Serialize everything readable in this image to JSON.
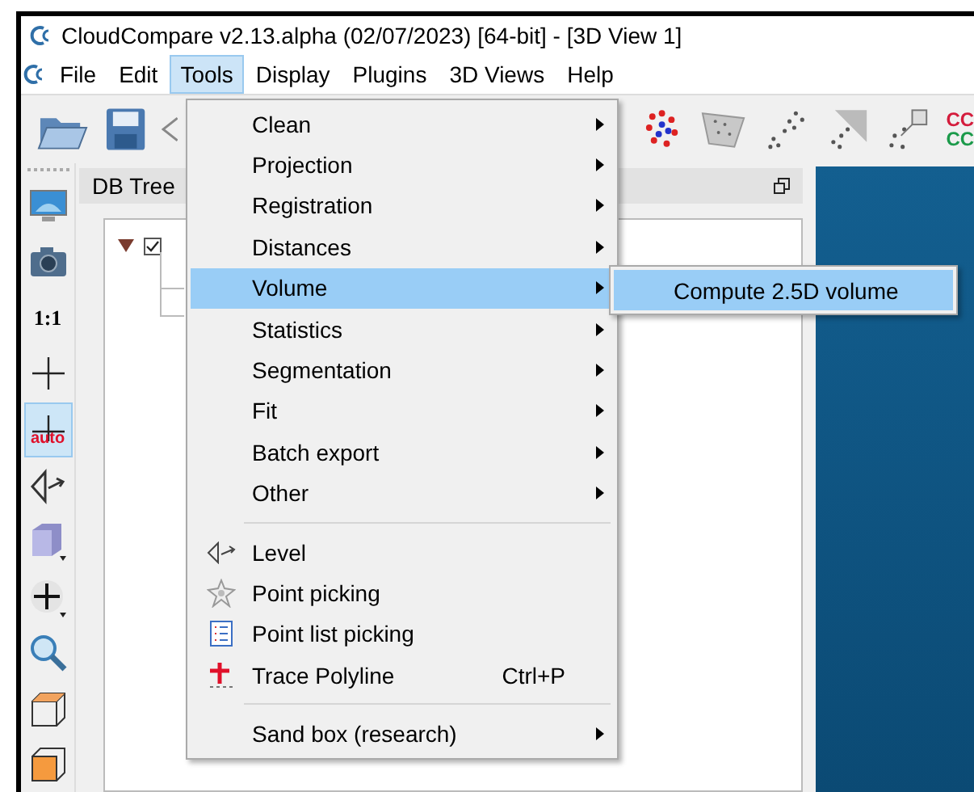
{
  "window": {
    "title": "CloudCompare v2.13.alpha (02/07/2023) [64-bit] - [3D View 1]"
  },
  "menubar": [
    {
      "label": "File",
      "selected": false
    },
    {
      "label": "Edit",
      "selected": false
    },
    {
      "label": "Tools",
      "selected": true
    },
    {
      "label": "Display",
      "selected": false
    },
    {
      "label": "Plugins",
      "selected": false
    },
    {
      "label": "3D Views",
      "selected": false
    },
    {
      "label": "Help",
      "selected": false
    }
  ],
  "toolbar": {
    "badge_lines": [
      "CC",
      "CC"
    ]
  },
  "side_toolbar": [
    {
      "kind": "display",
      "selected": false
    },
    {
      "kind": "camera",
      "selected": false
    },
    {
      "kind": "ratio",
      "label": "1:1",
      "selected": false
    },
    {
      "kind": "pivot",
      "selected": false
    },
    {
      "kind": "pivot-auto",
      "label": "auto",
      "selected": true
    },
    {
      "kind": "level",
      "selected": false
    },
    {
      "kind": "cube",
      "selected": false
    },
    {
      "kind": "move",
      "selected": false
    },
    {
      "kind": "zoom",
      "selected": false
    },
    {
      "kind": "box-wire",
      "selected": false
    },
    {
      "kind": "box-filled",
      "selected": false
    }
  ],
  "db_tree": {
    "title": "DB Tree",
    "root": {
      "expanded": true,
      "checked": true
    }
  },
  "tools_menu": {
    "items": [
      {
        "kind": "submenu",
        "label": "Clean",
        "selected": false
      },
      {
        "kind": "submenu",
        "label": "Projection",
        "selected": false
      },
      {
        "kind": "submenu",
        "label": "Registration",
        "selected": false
      },
      {
        "kind": "submenu",
        "label": "Distances",
        "selected": false
      },
      {
        "kind": "submenu",
        "label": "Volume",
        "selected": true
      },
      {
        "kind": "submenu",
        "label": "Statistics",
        "selected": false
      },
      {
        "kind": "submenu",
        "label": "Segmentation",
        "selected": false
      },
      {
        "kind": "submenu",
        "label": "Fit",
        "selected": false
      },
      {
        "kind": "submenu",
        "label": "Batch export",
        "selected": false
      },
      {
        "kind": "submenu",
        "label": "Other",
        "selected": false
      },
      {
        "kind": "separator"
      },
      {
        "kind": "action",
        "label": "Level",
        "selected": false
      },
      {
        "kind": "action",
        "label": "Point picking",
        "selected": false
      },
      {
        "kind": "action",
        "label": "Point list picking",
        "selected": false
      },
      {
        "kind": "action",
        "label": "Trace Polyline",
        "shortcut": "Ctrl+P",
        "selected": false
      },
      {
        "kind": "separator"
      },
      {
        "kind": "submenu",
        "label": "Sand box (research)",
        "selected": false
      }
    ]
  },
  "volume_submenu": {
    "items": [
      {
        "label": "Compute 2.5D volume",
        "selected": true
      }
    ]
  }
}
